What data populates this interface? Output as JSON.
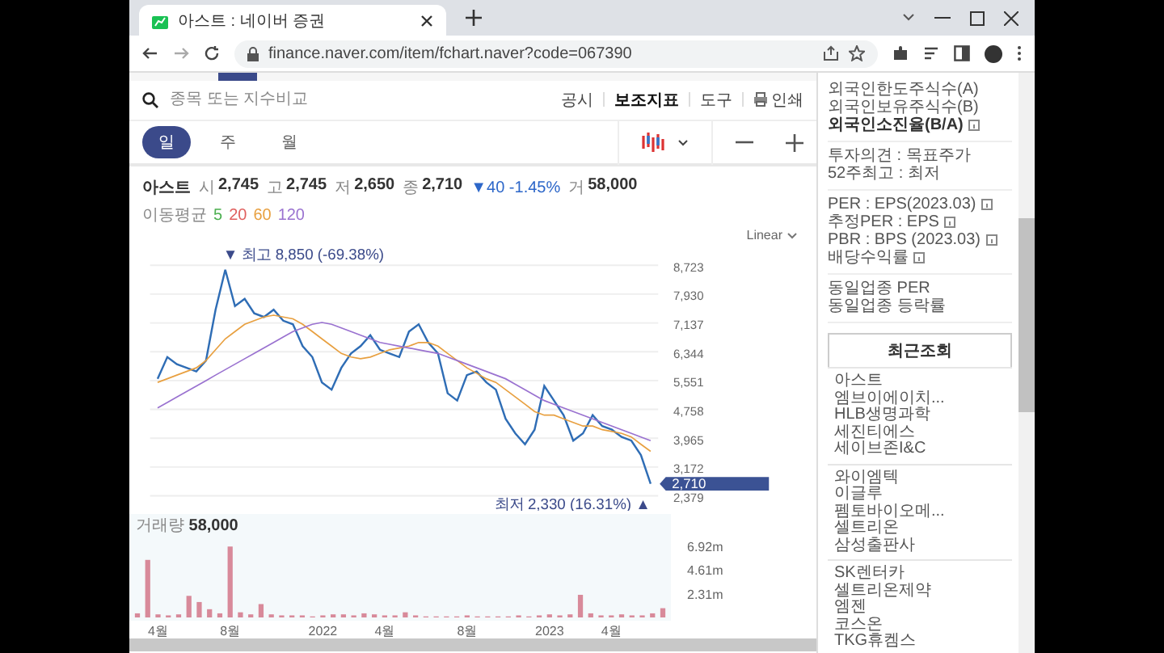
{
  "browser": {
    "tab_title": "아스트 : 네이버 증권",
    "url": "finance.naver.com/item/fchart.naver?code=067390"
  },
  "toolbar": {
    "search_placeholder": "종목 또는 지수비교",
    "menu": [
      {
        "label": "공시",
        "selected": false,
        "kind": "text"
      },
      {
        "label": "보조지표",
        "selected": true,
        "kind": "text"
      },
      {
        "label": "도구",
        "selected": false,
        "kind": "text"
      },
      {
        "label": "인쇄",
        "selected": false,
        "kind": "print"
      }
    ]
  },
  "periods": [
    {
      "label": "일",
      "selected": true
    },
    {
      "label": "주",
      "selected": false
    },
    {
      "label": "월",
      "selected": false
    }
  ],
  "quote": {
    "name": "아스트",
    "fields": [
      {
        "label": "시",
        "value": "2,745"
      },
      {
        "label": "고",
        "value": "2,745"
      },
      {
        "label": "저",
        "value": "2,650"
      },
      {
        "label": "종",
        "value": "2,710"
      }
    ],
    "change": "▼40 -1.45%",
    "volume": {
      "label": "거",
      "value": "58,000"
    }
  },
  "moving_averages": {
    "label": "이동평균",
    "periods": [
      {
        "label": "5",
        "color": "#4caf50"
      },
      {
        "label": "20",
        "color": "#e0605e"
      },
      {
        "label": "60",
        "color": "#e8a040"
      },
      {
        "label": "120",
        "color": "#9a72d0"
      }
    ]
  },
  "scale": "Linear",
  "price_chart": {
    "high_label": "▼ 최고 8,850 (-69.38%)",
    "low_label": "최저 2,330 (16.31%) ▲",
    "current": "2,710",
    "chart_data": {
      "type": "line",
      "grid": true,
      "ylim": [
        2379,
        8723
      ],
      "yticks": [
        {
          "value": 8723,
          "label": "8,723"
        },
        {
          "value": 7930,
          "label": "7,930"
        },
        {
          "value": 7137,
          "label": "7,137"
        },
        {
          "value": 6344,
          "label": "6,344"
        },
        {
          "value": 5551,
          "label": "5,551"
        },
        {
          "value": 4758,
          "label": "4,758"
        },
        {
          "value": 3965,
          "label": "3,965"
        },
        {
          "value": 3172,
          "label": "3,172"
        },
        {
          "value": 2379,
          "label": "2,379"
        }
      ],
      "series": [
        {
          "color": "#2f6db5",
          "values": [
            5600,
            6200,
            6000,
            5900,
            5800,
            6100,
            7500,
            8600,
            7600,
            7800,
            7400,
            7300,
            7500,
            7200,
            7100,
            6500,
            6200,
            5500,
            5300,
            5900,
            6300,
            6500,
            6800,
            6400,
            6300,
            6200,
            6900,
            7100,
            6600,
            6300,
            5200,
            5000,
            5700,
            5800,
            5500,
            5300,
            4500,
            4100,
            3800,
            4200,
            5400,
            5000,
            4600,
            3900,
            4100,
            4600,
            4300,
            4200,
            4000,
            3900,
            3500,
            2710
          ]
        },
        {
          "color": "#e8a040",
          "values": [
            5500,
            5600,
            5700,
            5800,
            5900,
            6100,
            6400,
            6700,
            6900,
            7100,
            7200,
            7300,
            7350,
            7300,
            7250,
            7100,
            6900,
            6700,
            6500,
            6300,
            6200,
            6150,
            6200,
            6300,
            6400,
            6450,
            6500,
            6600,
            6600,
            6500,
            6300,
            6100,
            5900,
            5750,
            5600,
            5500,
            5300,
            5100,
            4900,
            4700,
            4600,
            4600,
            4500,
            4400,
            4300,
            4300,
            4200,
            4150,
            4100,
            4000,
            3800,
            3600
          ]
        },
        {
          "color": "#9a72d0",
          "values": [
            4800,
            4950,
            5100,
            5250,
            5400,
            5550,
            5700,
            5850,
            6000,
            6150,
            6300,
            6450,
            6600,
            6750,
            6900,
            7000,
            7100,
            7150,
            7100,
            7000,
            6900,
            6800,
            6700,
            6600,
            6550,
            6500,
            6450,
            6400,
            6350,
            6300,
            6200,
            6100,
            6000,
            5900,
            5800,
            5700,
            5600,
            5450,
            5300,
            5150,
            5000,
            4900,
            4800,
            4700,
            4600,
            4500,
            4400,
            4300,
            4200,
            4100,
            4000,
            3900
          ]
        }
      ]
    }
  },
  "volume_chart": {
    "label": "거래량",
    "value": "58,000",
    "chart_data": {
      "type": "bar",
      "categories": [
        null,
        null,
        "4월",
        null,
        null,
        null,
        null,
        null,
        null,
        "8월",
        null,
        null,
        null,
        null,
        null,
        null,
        null,
        null,
        "2022",
        null,
        null,
        null,
        null,
        null,
        "4월",
        null,
        null,
        null,
        null,
        null,
        null,
        null,
        "8월",
        null,
        null,
        null,
        null,
        null,
        null,
        null,
        "2023",
        null,
        null,
        null,
        null,
        null,
        "4월",
        null,
        null,
        null,
        null,
        null
      ],
      "ylim": [
        0,
        6.92
      ],
      "yticks": [
        {
          "value": 6.92,
          "label": "6.92m"
        },
        {
          "value": 4.61,
          "label": "4.61m"
        },
        {
          "value": 2.31,
          "label": "2.31m"
        }
      ],
      "series": [
        {
          "color": "#d88a9a",
          "values": [
            0.4,
            5.6,
            0.3,
            0.2,
            0.3,
            2.1,
            1.5,
            0.8,
            0.4,
            6.9,
            0.5,
            0.3,
            1.3,
            0.3,
            0.2,
            0.2,
            0.2,
            0.1,
            0.2,
            0.3,
            0.3,
            0.2,
            0.4,
            0.3,
            0.2,
            0.2,
            0.5,
            0.2,
            0.1,
            0.1,
            0.1,
            0.1,
            0.2,
            0.1,
            0.1,
            0.1,
            0.1,
            0.2,
            0.1,
            0.2,
            0.3,
            0.2,
            0.3,
            2.2,
            0.4,
            0.2,
            0.2,
            0.3,
            0.2,
            0.2,
            0.4,
            0.9
          ]
        }
      ]
    }
  },
  "sidebar": {
    "groups": [
      [
        {
          "label": "외국인한도주식수(A)",
          "emphasized": false,
          "info": false
        },
        {
          "label": "외국인보유주식수(B)",
          "emphasized": false,
          "info": false
        },
        {
          "label": "외국인소진율(B/A)",
          "emphasized": true,
          "info": true
        }
      ],
      [
        {
          "label": "투자의견 : 목표주가",
          "emphasized": false,
          "info": false
        },
        {
          "label": "52주최고 : 최저",
          "emphasized": false,
          "info": false
        }
      ],
      [
        {
          "label": "PER : EPS(2023.03)",
          "emphasized": false,
          "info": true
        },
        {
          "label": "추정PER : EPS",
          "emphasized": false,
          "info": true
        },
        {
          "label": "PBR : BPS (2023.03)",
          "emphasized": false,
          "info": true
        },
        {
          "label": "배당수익률",
          "emphasized": false,
          "info": true
        }
      ],
      [
        {
          "label": "동일업종 PER",
          "emphasized": false,
          "info": false
        },
        {
          "label": "동일업종 등락률",
          "emphasized": false,
          "info": false
        }
      ]
    ],
    "recent_title": "최근조회",
    "recent_groups": [
      [
        "아스트",
        "엠브이에이치...",
        "HLB생명과학",
        "세진티에스",
        "세이브존I&C"
      ],
      [
        "와이엠텍",
        "이글루",
        "펨토바이오메...",
        "셀트리온",
        "삼성출판사"
      ],
      [
        "SK렌터카",
        "셀트리온제약",
        "엠젠",
        "코스온",
        "TKG휴켐스"
      ]
    ]
  }
}
